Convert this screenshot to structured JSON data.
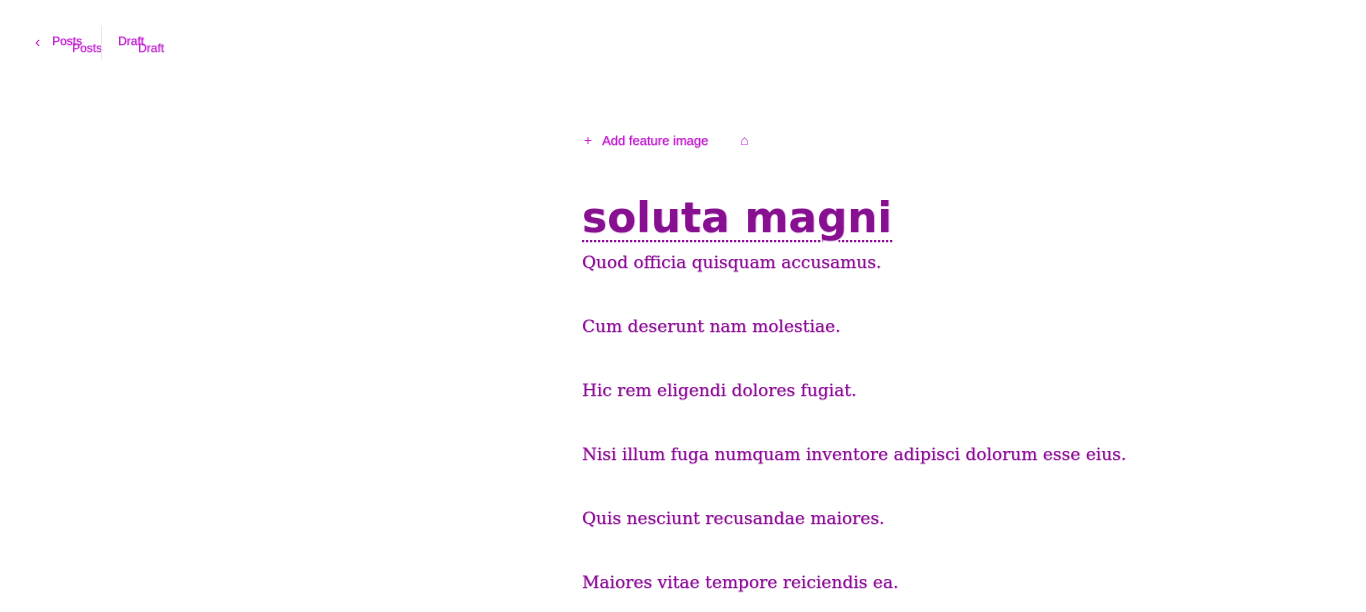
{
  "topbar": {
    "back_label": "Posts",
    "status_label": "Draft"
  },
  "editor": {
    "feature_image_label": "Add feature image",
    "title": "soluta magni",
    "paragraphs": [
      "Quod officia quisquam accusamus.",
      "Cum deserunt nam molestiae.",
      "Hic rem eligendi dolores fugiat.",
      "Nisi illum fuga numquam inventore adipisci dolorum esse eius.",
      "Quis nesciunt recusandae maiores.",
      "Maiores vitae tempore reiciendis ea."
    ]
  },
  "icons": {
    "back": "chevron-left-icon",
    "plus": "plus-icon",
    "image": "image-icon"
  },
  "colors": {
    "accent": "#c31bd3",
    "text": "#86108f"
  }
}
